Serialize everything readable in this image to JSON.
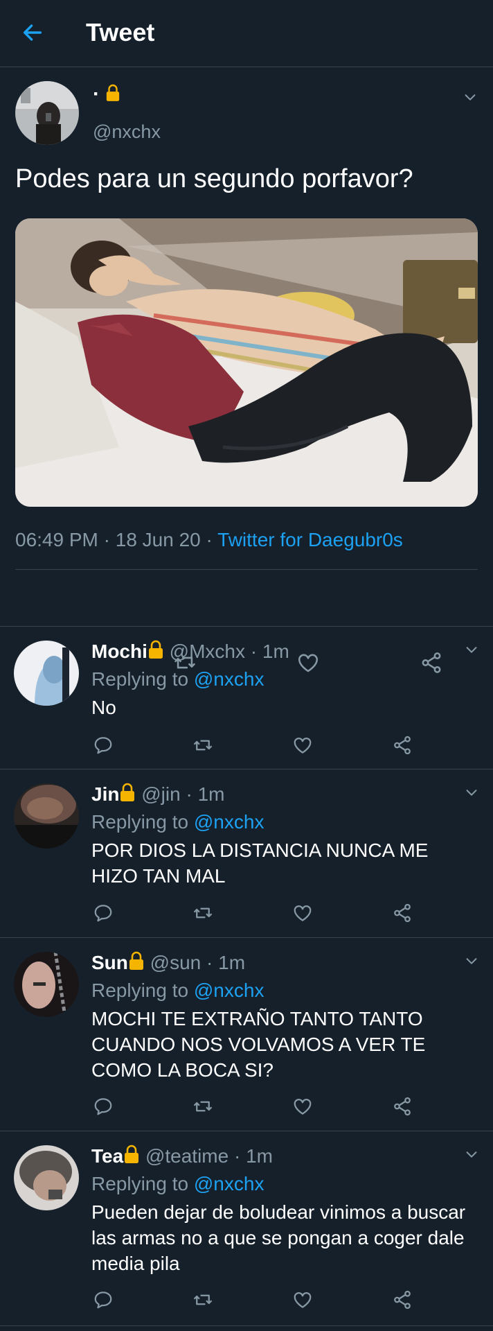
{
  "header": {
    "title": "Tweet"
  },
  "main_tweet": {
    "name": "·",
    "handle": "@nxchx",
    "text": "Podes para un segundo porfavor?",
    "time": "06:49 PM",
    "date": "18 Jun 20",
    "source": "Twitter for Daegubr0s",
    "meta_sep": " · "
  },
  "replies": [
    {
      "name": "Mochi",
      "handle": "@Mxchx",
      "time": "1m",
      "replying_prefix": "Replying to ",
      "mention": "@nxchx",
      "text": "No"
    },
    {
      "name": "Jin",
      "handle": "@jin",
      "time": "1m",
      "replying_prefix": "Replying to ",
      "mention": "@nxchx",
      "text": "POR DIOS LA DISTANCIA NUNCA ME HIZO TAN MAL"
    },
    {
      "name": "Sun",
      "handle": "@sun",
      "time": "1m",
      "replying_prefix": "Replying to ",
      "mention": "@nxchx",
      "text": "MOCHI TE EXTRAÑO TANTO TANTO CUANDO NOS VOLVAMOS A VER TE COMO LA BOCA SI?"
    },
    {
      "name": "Tea",
      "handle": "@teatime",
      "time": "1m",
      "replying_prefix": "Replying to ",
      "mention": "@nxchx",
      "text": "Pueden dejar de boludear vinimos a buscar las armas no a que se pongan a coger dale media pila"
    }
  ],
  "colors": {
    "background": "#15202b",
    "accent": "#1da1f2",
    "muted": "#8899a6",
    "divider": "#38444d",
    "lock": "#f5b400"
  },
  "icons": [
    "back-arrow-icon",
    "lock-icon",
    "chevron-down-icon",
    "reply-icon",
    "retweet-icon",
    "like-icon",
    "share-icon"
  ]
}
